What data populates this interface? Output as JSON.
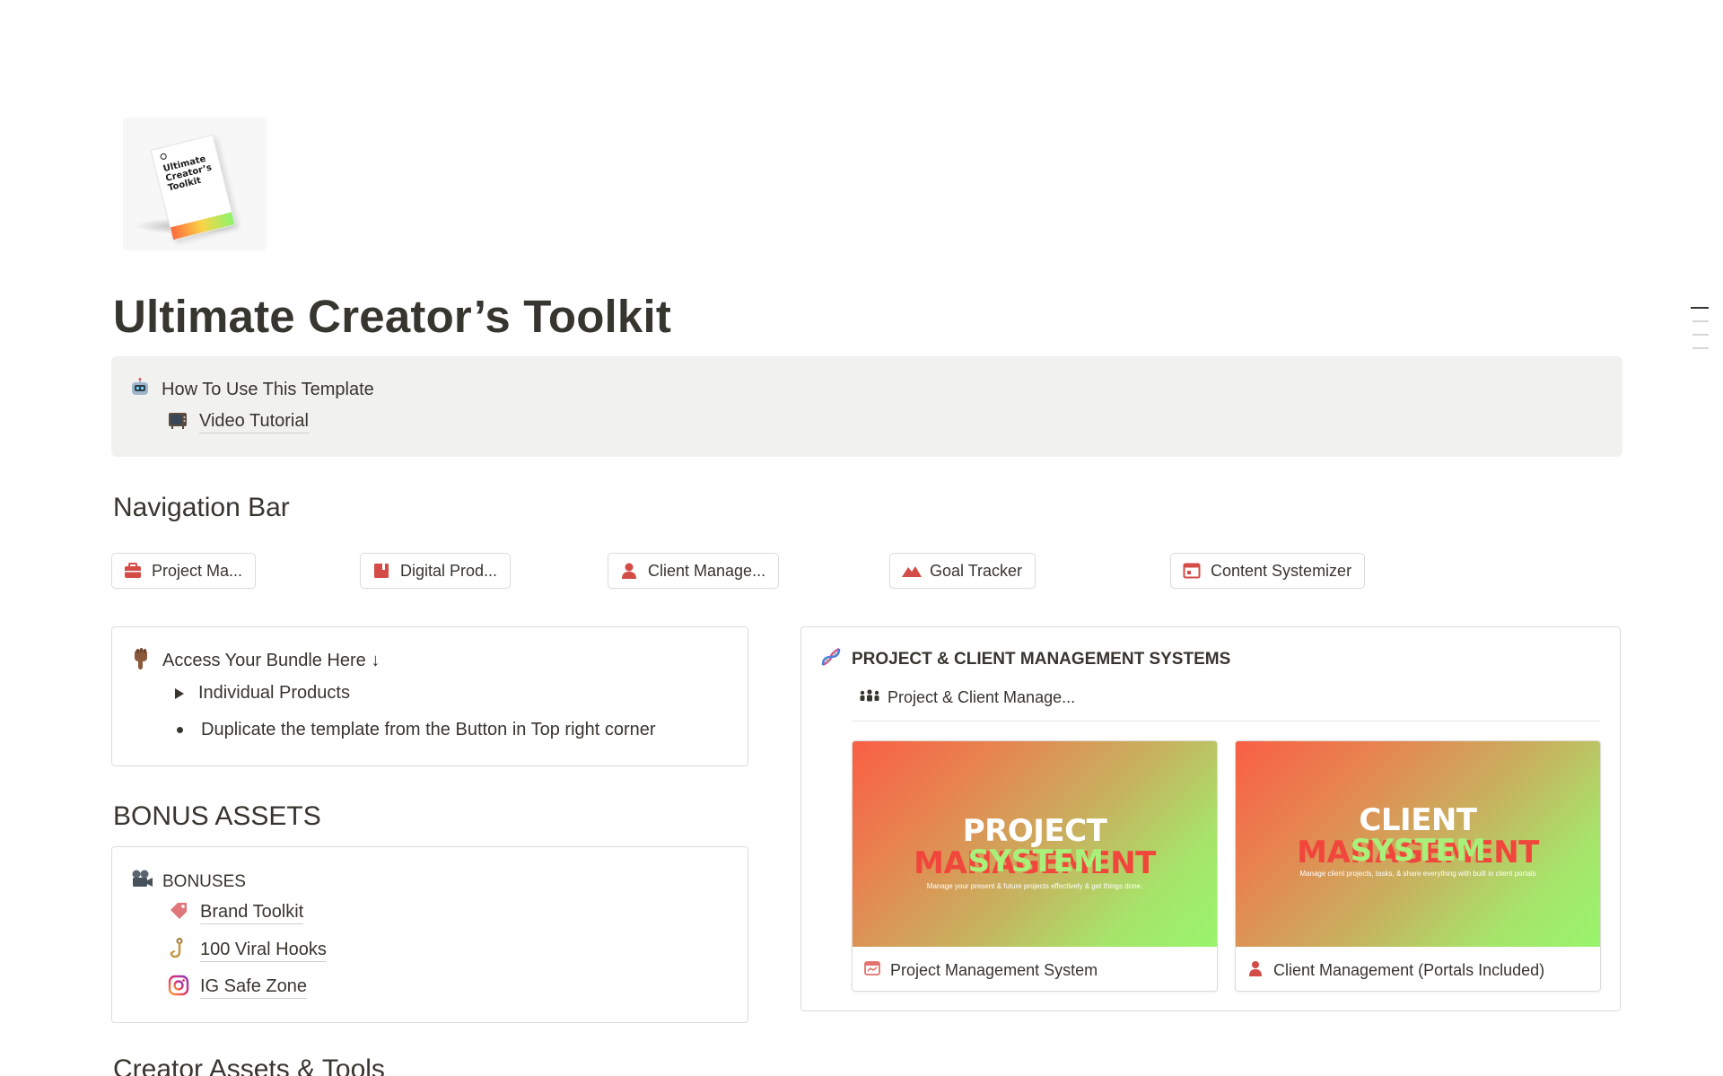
{
  "page": {
    "title": "Ultimate Creator’s Toolkit",
    "cover_icon_text": "Ultimate Creator’s Toolkit"
  },
  "callout": {
    "icon": "robot-face-icon",
    "heading": "How To Use This Template",
    "link_icon": "television-icon",
    "link_label": "Video Tutorial"
  },
  "navigation": {
    "heading": "Navigation Bar",
    "items": [
      {
        "label": "Project Ma...",
        "icon": "briefcase-icon"
      },
      {
        "label": "Digital Prod...",
        "icon": "book-icon"
      },
      {
        "label": "Client Manage...",
        "icon": "person-icon"
      },
      {
        "label": "Goal Tracker",
        "icon": "mountain-icon"
      },
      {
        "label": "Content Systemizer",
        "icon": "browser-window-icon"
      }
    ]
  },
  "bundle": {
    "icon": "pointing-down-hand-icon",
    "heading": "Access Your Bundle Here ↓",
    "toggle_label": "Individual Products",
    "bullet_label": "Duplicate the template from the Button in Top right corner"
  },
  "bonus": {
    "heading": "BONUS ASSETS",
    "callout_icon": "film-camera-icon",
    "callout_title": "BONUSES",
    "items": [
      {
        "label": "Brand Toolkit",
        "icon": "tag-icon"
      },
      {
        "label": "100 Viral Hooks",
        "icon": "hook-icon"
      },
      {
        "label": "IG Safe Zone",
        "icon": "instagram-icon"
      }
    ]
  },
  "systems": {
    "icon": "dna-icon",
    "title": "PROJECT & CLIENT MANAGEMENT SYSTEMS",
    "db_icon": "people-icon",
    "db_title": "Project & Client Manage...",
    "cards": [
      {
        "thumb_line1_white": "PROJECT",
        "thumb_line1_red": "MANAGEMENT",
        "thumb_line2": "SYSTEM",
        "thumb_sub": "Manage your present & future projects effectively & get things done.",
        "label": "Project Management System",
        "icon": "calendar-icon"
      },
      {
        "thumb_line1_white": "CLIENT",
        "thumb_line1_red": "MANAGEMENT",
        "thumb_line2": "SYSTEM",
        "thumb_sub": "Manage client projects, tasks, & share everything with built in client portals",
        "label": "Client Management (Portals Included)",
        "icon": "person-icon"
      }
    ]
  },
  "next_section": {
    "heading": "Creator Assets & Tools"
  },
  "colors": {
    "text": "#37352f",
    "callout_bg": "#f1f1ef",
    "accent_red": "#d44c47",
    "border": "#dcdcda"
  }
}
